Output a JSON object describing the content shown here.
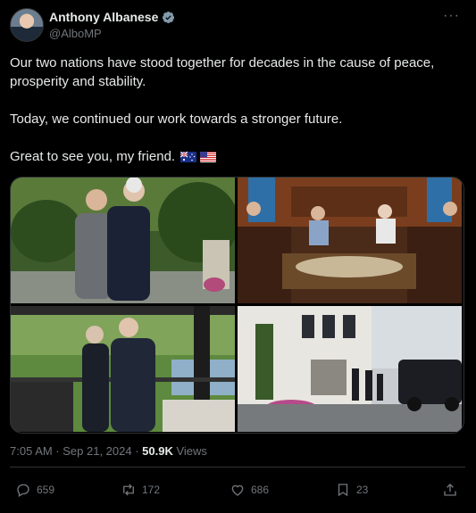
{
  "author": {
    "name": "Anthony Albanese",
    "handle": "@AlboMP"
  },
  "more_label": "···",
  "tweet": {
    "line1": "Our two nations have stood together for decades in the cause of peace, prosperity and stability.",
    "line2": "Today, we continued our work towards a stronger future.",
    "line3": "Great to see you, my friend.",
    "flags": [
      "australia-flag",
      "us-flag"
    ]
  },
  "meta": {
    "time": "7:05 AM · Sep 21, 2024 · ",
    "views_count": "50.9K",
    "views_label": " Views"
  },
  "actions": {
    "replies": "659",
    "reposts": "172",
    "likes": "686",
    "bookmarks": "23"
  },
  "colors": {
    "background": "#000000",
    "text": "#e7e9ea",
    "muted": "#71767b",
    "verified": "#829aab"
  }
}
